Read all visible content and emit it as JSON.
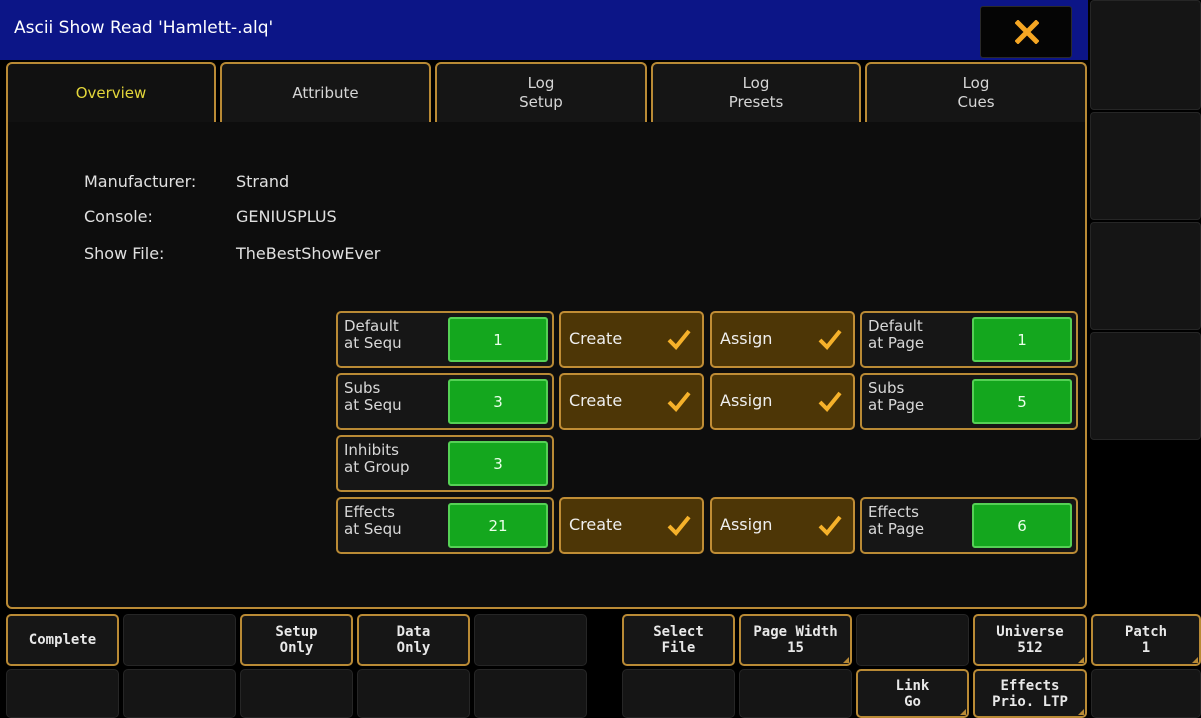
{
  "window": {
    "title": "Ascii Show Read 'Hamlett-.alq'",
    "close_icon": "close-x-icon",
    "accent": "#b98a35",
    "title_bg": "#0c1587"
  },
  "tabs": [
    {
      "label": "Overview",
      "active": true
    },
    {
      "label": "Attribute"
    },
    {
      "label": "Log\nSetup"
    },
    {
      "label": "Log\nPresets"
    },
    {
      "label": "Log\nCues"
    }
  ],
  "info": {
    "manufacturer_label": "Manufacturer:",
    "manufacturer_value": "Strand",
    "console_label": "Console:",
    "console_value": "GENIUSPLUS",
    "showfile_label": "Show File:",
    "showfile_value": "TheBestShowEver"
  },
  "grid": {
    "rows": [
      {
        "label": "Default\nat Sequ",
        "value": "1",
        "create": "Create",
        "assign": "Assign",
        "page_label": "Default\nat Page",
        "page_value": "1"
      },
      {
        "label": "Subs\nat Sequ",
        "value": "3",
        "create": "Create",
        "assign": "Assign",
        "page_label": "Subs\nat Page",
        "page_value": "5"
      },
      {
        "label": "Inhibits\nat Group",
        "value": "3"
      },
      {
        "label": "Effects\nat Sequ",
        "value": "21",
        "create": "Create",
        "assign": "Assign",
        "page_label": "Effects\nat Page",
        "page_value": "6"
      }
    ],
    "check_icon": "checkmark-icon",
    "value_color": "#14a71e"
  },
  "keys": {
    "complete": "Complete",
    "setup_only": "Setup\nOnly",
    "data_only": "Data\nOnly",
    "select_file": "Select\nFile",
    "page_width": "Page Width\n15",
    "universe": "Universe\n512",
    "patch": "Patch\n1",
    "link_go": "Link\nGo",
    "effects_prio": "Effects\nPrio. LTP"
  }
}
